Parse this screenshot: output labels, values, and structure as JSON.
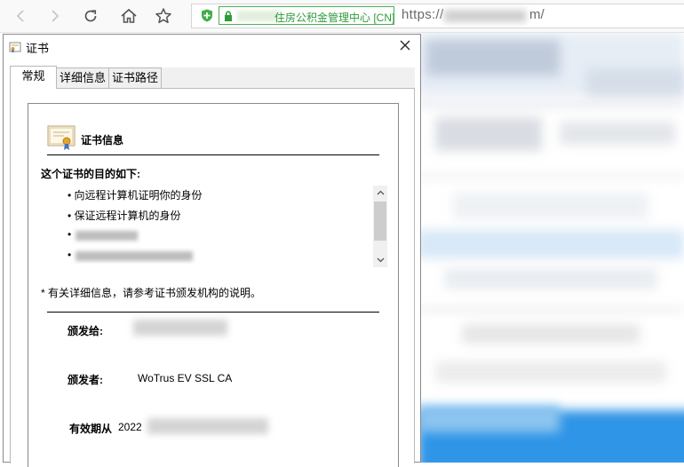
{
  "browser": {
    "ev_label": "住房公积金管理中心 [CN]",
    "url_scheme": "https://",
    "url_tail": "m/"
  },
  "dialog": {
    "title": "证书",
    "tabs": [
      {
        "label": "常规"
      },
      {
        "label": "详细信息"
      },
      {
        "label": "证书路径"
      }
    ],
    "heading": "证书信息",
    "purpose_title": "这个证书的目的如下:",
    "purposes": [
      {
        "bullet": "•",
        "text": "向远程计算机证明你的身份"
      },
      {
        "bullet": "•",
        "text": "保证远程计算机的身份"
      },
      {
        "bullet": "•",
        "text": ""
      },
      {
        "bullet": "•",
        "text": ""
      }
    ],
    "note": "* 有关详细信息，请参考证书颁发机构的说明。",
    "issued_to_label": "颁发给:",
    "issued_to_value": "",
    "issued_by_label": "颁发者:",
    "issued_by_value": "WoTrus EV SSL CA",
    "valid_from_label": "有效期从",
    "valid_from_value": "2022"
  }
}
